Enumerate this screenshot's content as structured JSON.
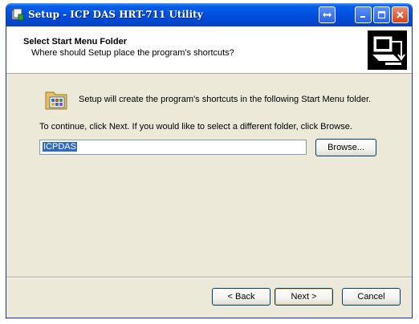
{
  "window": {
    "title": "Setup - ICP DAS HRT-711 Utility",
    "titlebar_buttons": [
      "restore-icon",
      "minimize-icon",
      "maximize-icon",
      "close-icon"
    ]
  },
  "header": {
    "title": "Select Start Menu Folder",
    "subtitle": "Where should Setup place the program's shortcuts?"
  },
  "body": {
    "intro": "Setup will create the program's shortcuts in the following Start Menu folder.",
    "instruction": "To continue, click Next. If you would like to select a different folder, click Browse.",
    "folder_value": "ICPDAS",
    "browse_label": "Browse..."
  },
  "footer": {
    "back_label": "< Back",
    "next_label": "Next >",
    "cancel_label": "Cancel"
  },
  "colors": {
    "titlebar": "#0054e3",
    "dialog_bg": "#ece9d8",
    "selection": "#316ac5",
    "close_button": "#d6461c"
  }
}
